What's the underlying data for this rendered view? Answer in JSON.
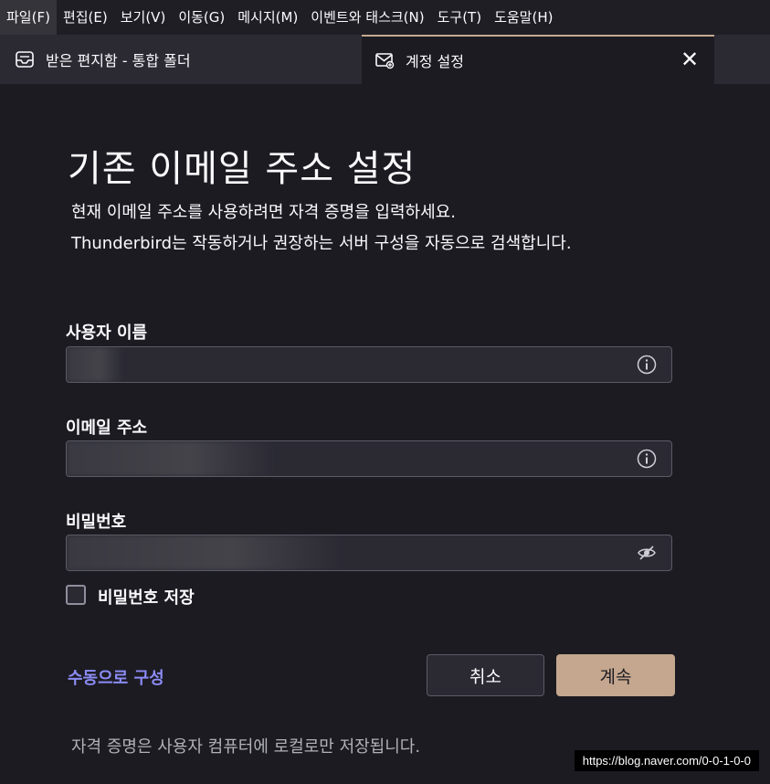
{
  "menu": [
    {
      "label": "파일(F)"
    },
    {
      "label": "편집(E)"
    },
    {
      "label": "보기(V)"
    },
    {
      "label": "이동(G)"
    },
    {
      "label": "메시지(M)"
    },
    {
      "label": "이벤트와 태스크(N)"
    },
    {
      "label": "도구(T)"
    },
    {
      "label": "도움말(H)"
    }
  ],
  "tabs": {
    "inbox": {
      "label": "받은 편지함 - 통합 폴더",
      "icon": "inbox-icon"
    },
    "account": {
      "label": "계정 설정",
      "icon": "mail-settings-icon",
      "close": "✕"
    }
  },
  "form": {
    "title": "기존 이메일 주소 설정",
    "description_line1": "현재 이메일 주소를 사용하려면 자격 증명을 입력하세요.",
    "description_line2": "Thunderbird는 작동하거나 권장하는 서버 구성을 자동으로 검색합니다.",
    "username_label": "사용자 이름",
    "username_value": "",
    "email_label": "이메일 주소",
    "email_value": "",
    "password_label": "비밀번호",
    "password_value": "",
    "remember_password_label": "비밀번호 저장",
    "remember_password_checked": false,
    "manual_config_link": "수동으로 구성",
    "cancel_label": "취소",
    "continue_label": "계속",
    "footer_note": "자격 증명은 사용자 컴퓨터에 로컬로만 저장됩니다."
  },
  "watermark": "https://blog.naver.com/0-0-1-0-0",
  "colors": {
    "background": "#1c1b22",
    "accent_button": "#c4a78e",
    "link": "#8c8cf6"
  }
}
